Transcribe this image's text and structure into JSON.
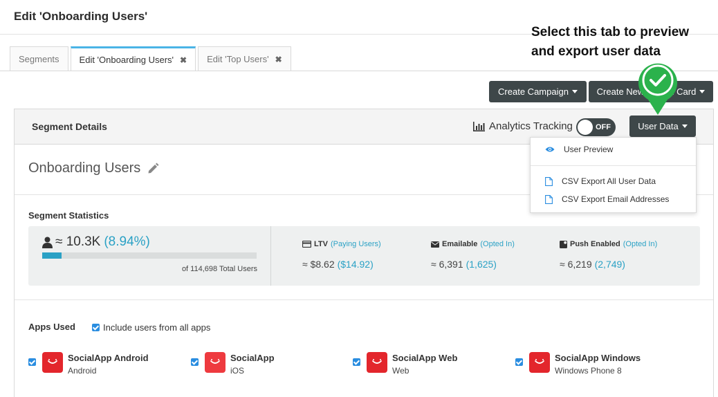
{
  "page": {
    "title": "Edit 'Onboarding Users'"
  },
  "tabs": [
    {
      "label": "Segments",
      "closable": false
    },
    {
      "label": "Edit 'Onboarding Users'",
      "closable": true,
      "active": true
    },
    {
      "label": "Edit 'Top Users'",
      "closable": true
    }
  ],
  "tab_close_glyph": "✖",
  "actions": {
    "create_campaign": "Create Campaign",
    "create_news_card": "Create News Feed Card",
    "create_news_card_visible": "Create New",
    "create_news_card_visible_tail": "d Card"
  },
  "annotation": {
    "line1": "Select this tab to preview",
    "line2": "and export user data",
    "marker_color": "#2bb24c"
  },
  "panel": {
    "title": "Segment Details",
    "analytics_label": "Analytics Tracking",
    "toggle_label": "OFF",
    "user_data_button": "User Data"
  },
  "segment": {
    "name": "Onboarding Users"
  },
  "stats": {
    "title": "Segment Statistics",
    "user_count": "≈ 10.3K",
    "user_pct": "(8.94%)",
    "progress_fraction": 0.0894,
    "total_users": "of 114,698 Total Users",
    "metrics": [
      {
        "label": "LTV",
        "sub": "(Paying Users)",
        "value": "≈ $8.62",
        "accent": "($14.92)",
        "icon": "credit-card-icon"
      },
      {
        "label": "Emailable",
        "sub": "(Opted In)",
        "value": "≈ 6,391",
        "accent": "(1,625)",
        "icon": "envelope-icon"
      },
      {
        "label": "Push Enabled",
        "sub": "(Opted In)",
        "value": "≈ 6,219",
        "accent": "(2,749)",
        "icon": "push-icon"
      }
    ]
  },
  "apps": {
    "title": "Apps Used",
    "include_all": "Include users from all apps",
    "items": [
      {
        "name": "SocialApp Android",
        "platform": "Android"
      },
      {
        "name": "SocialApp",
        "platform": "iOS"
      },
      {
        "name": "SocialApp Web",
        "platform": "Web"
      },
      {
        "name": "SocialApp Windows",
        "platform": "Windows Phone 8"
      }
    ]
  },
  "dropdown": {
    "items": [
      {
        "label": "User Preview",
        "icon": "eye-icon"
      },
      {
        "label": "CSV Export All User Data",
        "icon": "file-icon"
      },
      {
        "label": "CSV Export Email Addresses",
        "icon": "file-icon"
      }
    ]
  },
  "colors": {
    "accent": "#2aa1c5",
    "dark_button": "#3e4749",
    "tab_active": "#4ab4e6",
    "app_red": "#e3262c",
    "checkbox": "#2a8de0"
  }
}
